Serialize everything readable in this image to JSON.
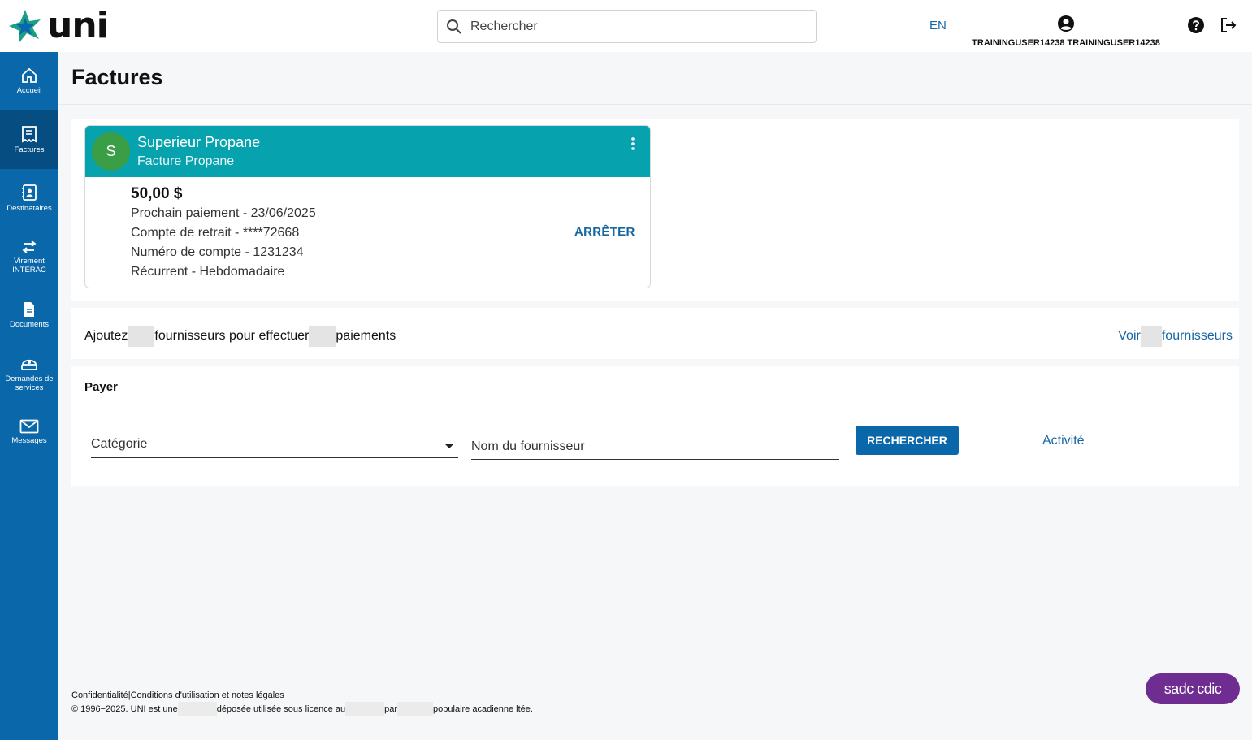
{
  "header": {
    "logo_text": "uni",
    "search_placeholder": "Rechercher",
    "language": "EN",
    "user_name": "TRAININGUSER14238 TRAININGUSER14238"
  },
  "sidebar": {
    "items": [
      {
        "label": "Accueil",
        "icon": "home-icon"
      },
      {
        "label": "Factures",
        "icon": "receipt-icon",
        "active": true
      },
      {
        "label": "Destinataires",
        "icon": "contacts-icon"
      },
      {
        "label": "Virement INTERAC",
        "icon": "transfer-icon"
      },
      {
        "label": "Documents",
        "icon": "document-icon"
      },
      {
        "label": "Demandes de services",
        "icon": "service-request-icon"
      },
      {
        "label": "Messages",
        "icon": "mail-icon"
      }
    ]
  },
  "page": {
    "title": "Factures"
  },
  "bill_card": {
    "avatar_letter": "S",
    "vendor": "Superieur Propane",
    "bill_type": "Facture Propane",
    "amount": "50,00 $",
    "next_payment": "Prochain paiement - 23/06/2025",
    "withdrawal_account": "Compte de retrait - ****72668",
    "account_number": "Numéro de compte - 1231234",
    "recurrence": "Récurrent - Hebdomadaire",
    "stop_label": "ARRÊTER"
  },
  "promo": {
    "text_1": "Ajoutez",
    "text_2": "fournisseurs pour effectuer",
    "text_3": "paiements",
    "link_1": "Voir",
    "link_2": "fournisseurs"
  },
  "pay": {
    "title": "Payer",
    "category_label": "Catégorie",
    "vendor_placeholder": "Nom du fournisseur",
    "search_button": "RECHERCHER",
    "activity_link": "Activité"
  },
  "footer": {
    "privacy": "Confidentialité",
    "terms": "Conditions d'utilisation et notes légales",
    "copyright_1": "© 1996−2025. UNI est une",
    "copyright_2": "déposée utilisée sous licence au",
    "copyright_3": "par",
    "copyright_4": "populaire acadienne ltée.",
    "badge": "sadc cdic"
  },
  "colors": {
    "brand_blue": "#0a67aa",
    "card_teal": "#06a2ae",
    "avatar_green": "#3a9e46",
    "link_blue": "#1666a6",
    "badge_purple": "#6f2d91"
  }
}
